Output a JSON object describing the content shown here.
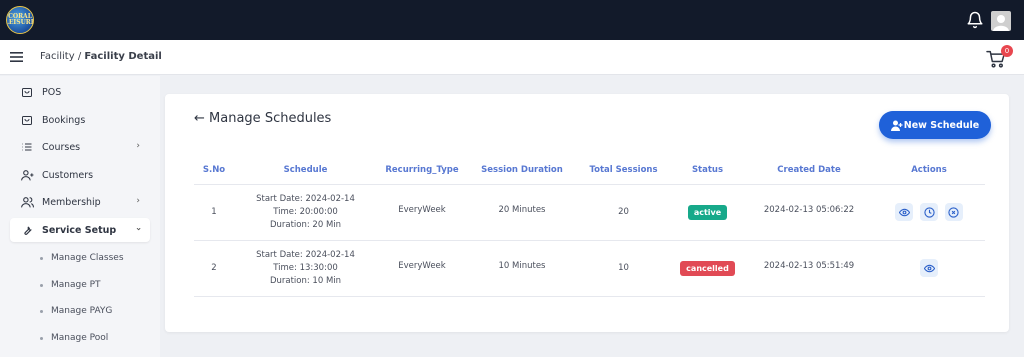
{
  "app": {
    "logo_text": "CORAL LEISURE",
    "accent": "#1f61d9",
    "topbar_bg": "#121a2a"
  },
  "header": {
    "breadcrumb_parent": "Facility",
    "breadcrumb_sep": " / ",
    "breadcrumb_current": "Facility Detail",
    "cart_count": "0"
  },
  "sidebar": {
    "items": [
      {
        "label": "POS",
        "icon": "bag-icon"
      },
      {
        "label": "Bookings",
        "icon": "bag-icon"
      },
      {
        "label": "Courses",
        "icon": "list-icon",
        "has_chevron": true
      },
      {
        "label": "Customers",
        "icon": "user-plus-icon"
      },
      {
        "label": "Membership",
        "icon": "users-icon",
        "has_chevron": true
      },
      {
        "label": "Service Setup",
        "icon": "wrench-icon",
        "expanded": true
      }
    ],
    "subitems": [
      "Manage Classes",
      "Manage PT",
      "Manage PAYG",
      "Manage Pool"
    ]
  },
  "main": {
    "title": "Manage Schedules",
    "new_button": "New Schedule",
    "columns": [
      "S.No",
      "Schedule",
      "Recurring_Type",
      "Session Duration",
      "Total Sessions",
      "Status",
      "Created Date",
      "Actions"
    ],
    "rows": [
      {
        "sno": "1",
        "start": "Start Date: 2024-02-14",
        "time": "Time: 20:00:00",
        "duration": "Duration: 20 Min",
        "recurring": "EveryWeek",
        "session_duration": "20 Minutes",
        "total": "20",
        "status": "active",
        "created": "2024-02-13 05:06:22",
        "actions": [
          "eye-icon",
          "clock-icon",
          "cancel-icon"
        ]
      },
      {
        "sno": "2",
        "start": "Start Date: 2024-02-14",
        "time": "Time: 13:30:00",
        "duration": "Duration: 10 Min",
        "recurring": "EveryWeek",
        "session_duration": "10 Minutes",
        "total": "10",
        "status": "cancelled",
        "created": "2024-02-13 05:51:49",
        "actions": [
          "eye-icon"
        ]
      }
    ]
  }
}
